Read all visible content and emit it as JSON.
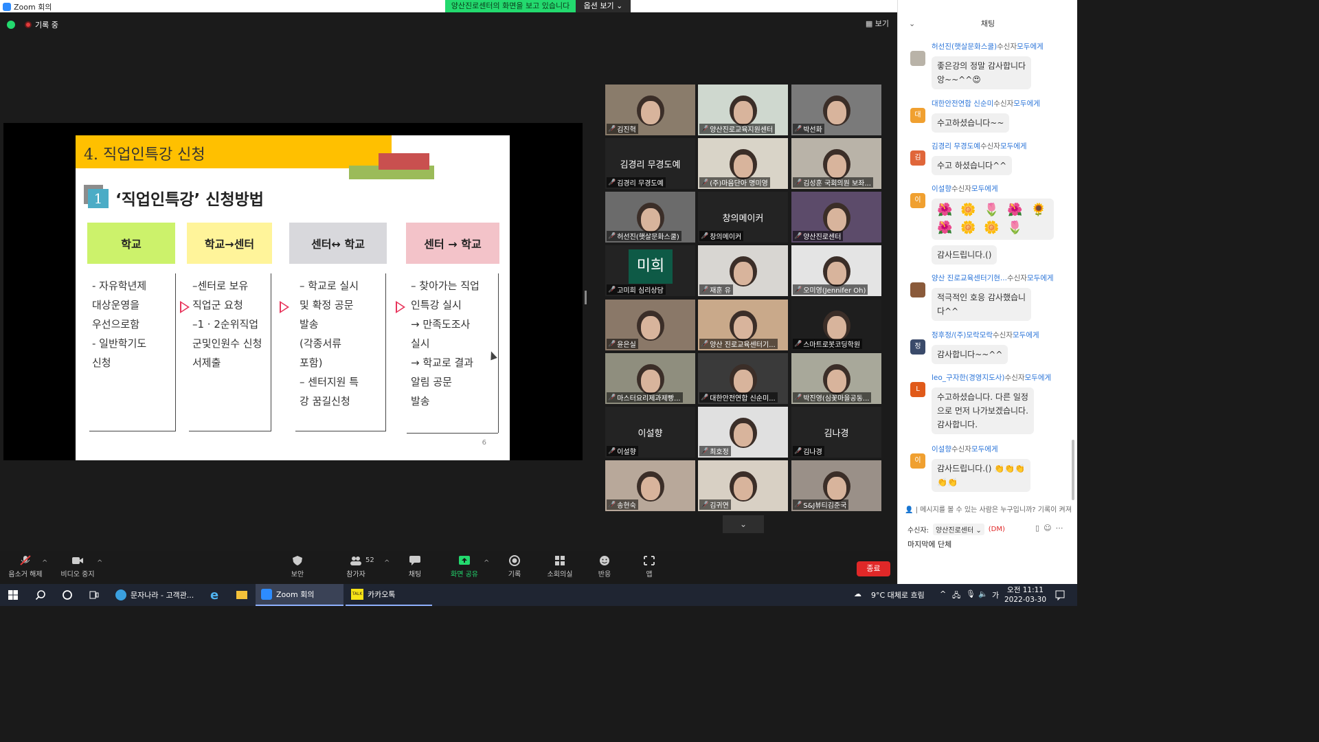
{
  "window": {
    "title": "Zoom 회의",
    "share_banner": "양산진로센터의 화면을 보고 있습니다",
    "share_options": "옵션 보기 ⌄"
  },
  "meeting": {
    "recording": "기록 중",
    "view_button": "보기"
  },
  "slide": {
    "title": "4. 직업인특강 신청",
    "section_number": "1",
    "subtitle": "‘직업인특강’ 신청방법",
    "columns": [
      {
        "head": "학교",
        "color": "#ccf26b",
        "body": "- 자유학년제\n  대상운영을\n  우선으로함\n- 일반학기도\n  신청"
      },
      {
        "head": "학교→센터",
        "color": "#fff49a",
        "body": "–센터로 보유\n 직업군 요청\n–1 · 2순위직업\n 군및인원수 신청\n 서제출"
      },
      {
        "head": "센터↔ 학교",
        "color": "#d8d8dc",
        "body": "–  학교로 실시\n    및 확정 공문\n    발송\n    (각종서류\n    포함)\n–  센터지원 특\n    강 꿈길신청"
      },
      {
        "head": "센터 → 학교",
        "color": "#f3c3c9",
        "body": "–  찾아가는 직업\n    인특강 실시\n→ 만족도조사\n    실시\n→ 학교로 결과\n    알림 공문\n    발송"
      }
    ],
    "page_number": "6"
  },
  "participants": [
    {
      "name": "김진혁",
      "video": true,
      "bg": "#8a7c6b"
    },
    {
      "name": "양산진로교육지원센터",
      "video": true,
      "bg": "#cfd8cf"
    },
    {
      "name": "박선화",
      "video": true,
      "bg": "#7a7a7a"
    },
    {
      "name": "김경리 무경도예",
      "video": false,
      "center": "김경리 무경도예"
    },
    {
      "name": "(주)마음단아 명미영",
      "video": true,
      "bg": "#d9d4c8"
    },
    {
      "name": "김성훈 국회의원 보좌...",
      "video": true,
      "bg": "#b9b3a8"
    },
    {
      "name": "허선진(햇살문화스쿨)",
      "video": true,
      "bg": "#6b6b6b"
    },
    {
      "name": "창의메이커",
      "video": false,
      "center": "창의메이커"
    },
    {
      "name": "양산진로센터",
      "video": true,
      "bg": "#5c4b6a",
      "active": true
    },
    {
      "name": "고미희 심리상담",
      "video": false,
      "logo": "미희"
    },
    {
      "name": "재훈 유",
      "video": true,
      "bg": "#d8d6d2"
    },
    {
      "name": "오미영(Jennifer Oh)",
      "video": true,
      "bg": "#e4e4e4"
    },
    {
      "name": "윤은실",
      "video": true,
      "bg": "#8a7868"
    },
    {
      "name": "양산 진로교육센터기...",
      "video": true,
      "bg": "#c9a98a"
    },
    {
      "name": "스마트로봇코딩학원",
      "video": true,
      "bg": "#1e1e1e"
    },
    {
      "name": "마스터요리제과제빵...",
      "video": true,
      "bg": "#8f8e7e"
    },
    {
      "name": "대한안전연합 신순미...",
      "video": true,
      "bg": "#3a3a3a"
    },
    {
      "name": "박진영(심꽃마을공동...",
      "video": true,
      "bg": "#a8a89a"
    },
    {
      "name": "이설향",
      "video": false,
      "center": "이설향"
    },
    {
      "name": "최호정",
      "video": true,
      "bg": "#e0e0e0"
    },
    {
      "name": "김나경",
      "video": false,
      "center": "김나경"
    },
    {
      "name": "송현숙",
      "video": true,
      "bg": "#b8a89a"
    },
    {
      "name": "김귀연",
      "video": true,
      "bg": "#d8d0c4"
    },
    {
      "name": "S&J뷰티김준국",
      "video": true,
      "bg": "#9a9088"
    }
  ],
  "toolbar": {
    "unmute": "음소거 해제",
    "stop_video": "비디오 중지",
    "security": "보안",
    "participants": "참가자",
    "participant_count": "52",
    "chat": "채팅",
    "share_screen": "화면 공유",
    "record": "기록",
    "breakout": "소회의실",
    "reactions": "반응",
    "apps": "앱",
    "end": "종료"
  },
  "chat": {
    "title": "채팅",
    "to_label": "수신자",
    "all_label": "모두에게",
    "messages": [
      {
        "sender": "허선진(햇살문화스쿨)",
        "avatar": "",
        "avatar_color": "#b9b3a8",
        "text": "좋은강의 정말 감사합니다\n앙~~^^😍"
      },
      {
        "sender": "대한안전연합 신순미",
        "avatar": "대",
        "avatar_color": "#f0a030",
        "text": "수고하셨습니다~~"
      },
      {
        "sender": "김경리 무경도예",
        "avatar": "김",
        "avatar_color": "#e0663a",
        "text": "수고 하셨습니다^^"
      },
      {
        "sender": "이설향",
        "avatar": "이",
        "avatar_color": "#f0a030",
        "text": "🌺 🌼 🌷 🌺 🌻\n🌺 🌼 🌼 🌷",
        "text2": "감사드립니다.()"
      },
      {
        "sender": "양산 진로교육센터기현...",
        "avatar": "",
        "avatar_color": "#8a5a3a",
        "text": "적극적인 호응 감사했습니\n다^^"
      },
      {
        "sender": "정후정/(주)모락모락",
        "avatar": "정",
        "avatar_color": "#3a4a6a",
        "text": "감사합니다~~^^"
      },
      {
        "sender": "leo_구자한(경영지도사)",
        "avatar": "L",
        "avatar_color": "#e05a1a",
        "text": "수고하셨습니다. 다른 일정\n으로 먼저 나가보겠습니다.\n감사합니다."
      },
      {
        "sender": "이설향",
        "avatar": "이",
        "avatar_color": "#f0a030",
        "text": "감사드립니다.() 👏👏👏\n👏👏"
      }
    ],
    "privacy_note": "메시지를 볼 수 있는 사람은 누구입니까? 기록이 켜져",
    "recipient_label": "수신자:",
    "recipient_value": "양산진로센터 ⌄",
    "dm_tag": "(DM)",
    "input_text": "마지막에 단체"
  },
  "taskbar": {
    "apps": [
      {
        "label": "문자나라 - 고객관..."
      },
      {
        "label": "Zoom 회의"
      },
      {
        "label": "카카오톡"
      }
    ],
    "weather": "9°C  대체로 흐림",
    "ime": "가",
    "time": "오전 11:11",
    "date": "2022-03-30"
  }
}
